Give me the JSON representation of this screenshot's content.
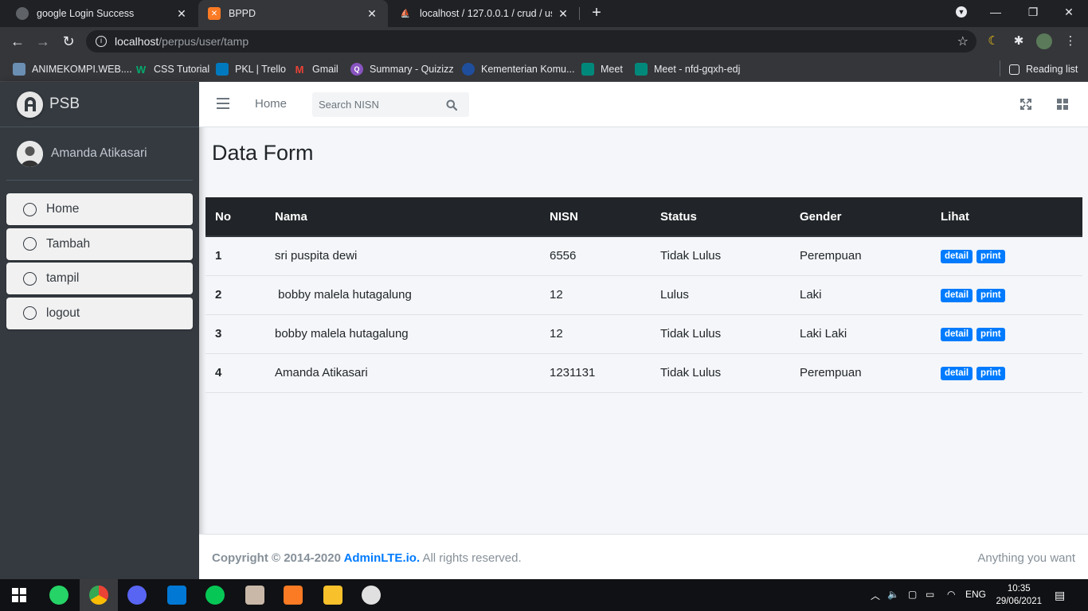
{
  "browser": {
    "tabs": [
      {
        "title": "google Login Success",
        "active": false
      },
      {
        "title": "BPPD",
        "active": true
      },
      {
        "title": "localhost / 127.0.0.1 / crud / user",
        "active": false
      }
    ],
    "url_host": "localhost",
    "url_path": "/perpus/user/tamp",
    "bookmarks": [
      {
        "label": "ANIMEKOMPI.WEB....",
        "color": "#6b8fb3"
      },
      {
        "label": "CSS Tutorial",
        "color": "#04aa6d"
      },
      {
        "label": "PKL | Trello",
        "color": "#0079bf"
      },
      {
        "label": "Gmail",
        "color": "#ea4335"
      },
      {
        "label": "Summary - Quizizz",
        "color": "#8854c0"
      },
      {
        "label": "Kementerian Komu...",
        "color": "#1f4e9c"
      },
      {
        "label": "Meet",
        "color": "#00897b"
      },
      {
        "label": "Meet - nfd-gqxh-edj",
        "color": "#00897b"
      }
    ],
    "reading_list": "Reading list"
  },
  "sidebar": {
    "brand": "PSB",
    "user": "Amanda Atikasari",
    "items": [
      {
        "label": "Home"
      },
      {
        "label": "Tambah"
      },
      {
        "label": "tampil"
      },
      {
        "label": "logout"
      }
    ]
  },
  "topnav": {
    "home": "Home",
    "search_placeholder": "Search NISN"
  },
  "content": {
    "title": "Data Form",
    "table": {
      "headers": [
        "No",
        "Nama",
        "NISN",
        "Status",
        "Gender",
        "Lihat"
      ],
      "rows": [
        {
          "no": "1",
          "nama": "sri puspita dewi",
          "nisn": "6556",
          "status": "Tidak Lulus",
          "gender": "Perempuan"
        },
        {
          "no": "2",
          "nama": " bobby malela hutagalung",
          "nisn": "12",
          "status": "Lulus",
          "gender": "Laki"
        },
        {
          "no": "3",
          "nama": "bobby malela hutagalung",
          "nisn": "12",
          "status": "Tidak Lulus",
          "gender": "Laki Laki"
        },
        {
          "no": "4",
          "nama": "Amanda Atikasari",
          "nisn": "1231131",
          "status": "Tidak Lulus",
          "gender": "Perempuan"
        }
      ],
      "detail_label": "detail",
      "print_label": "print"
    }
  },
  "footer": {
    "copy_prefix": "Copyright © 2014-2020 ",
    "copy_link": "AdminLTE.io.",
    "copy_suffix": " All rights reserved.",
    "right": "Anything you want"
  },
  "taskbar": {
    "lang": "ENG",
    "time": "10:35",
    "date": "29/06/2021"
  },
  "colors": {
    "accent": "#007bff",
    "sidebar": "#343a40",
    "table_head": "#212529"
  }
}
